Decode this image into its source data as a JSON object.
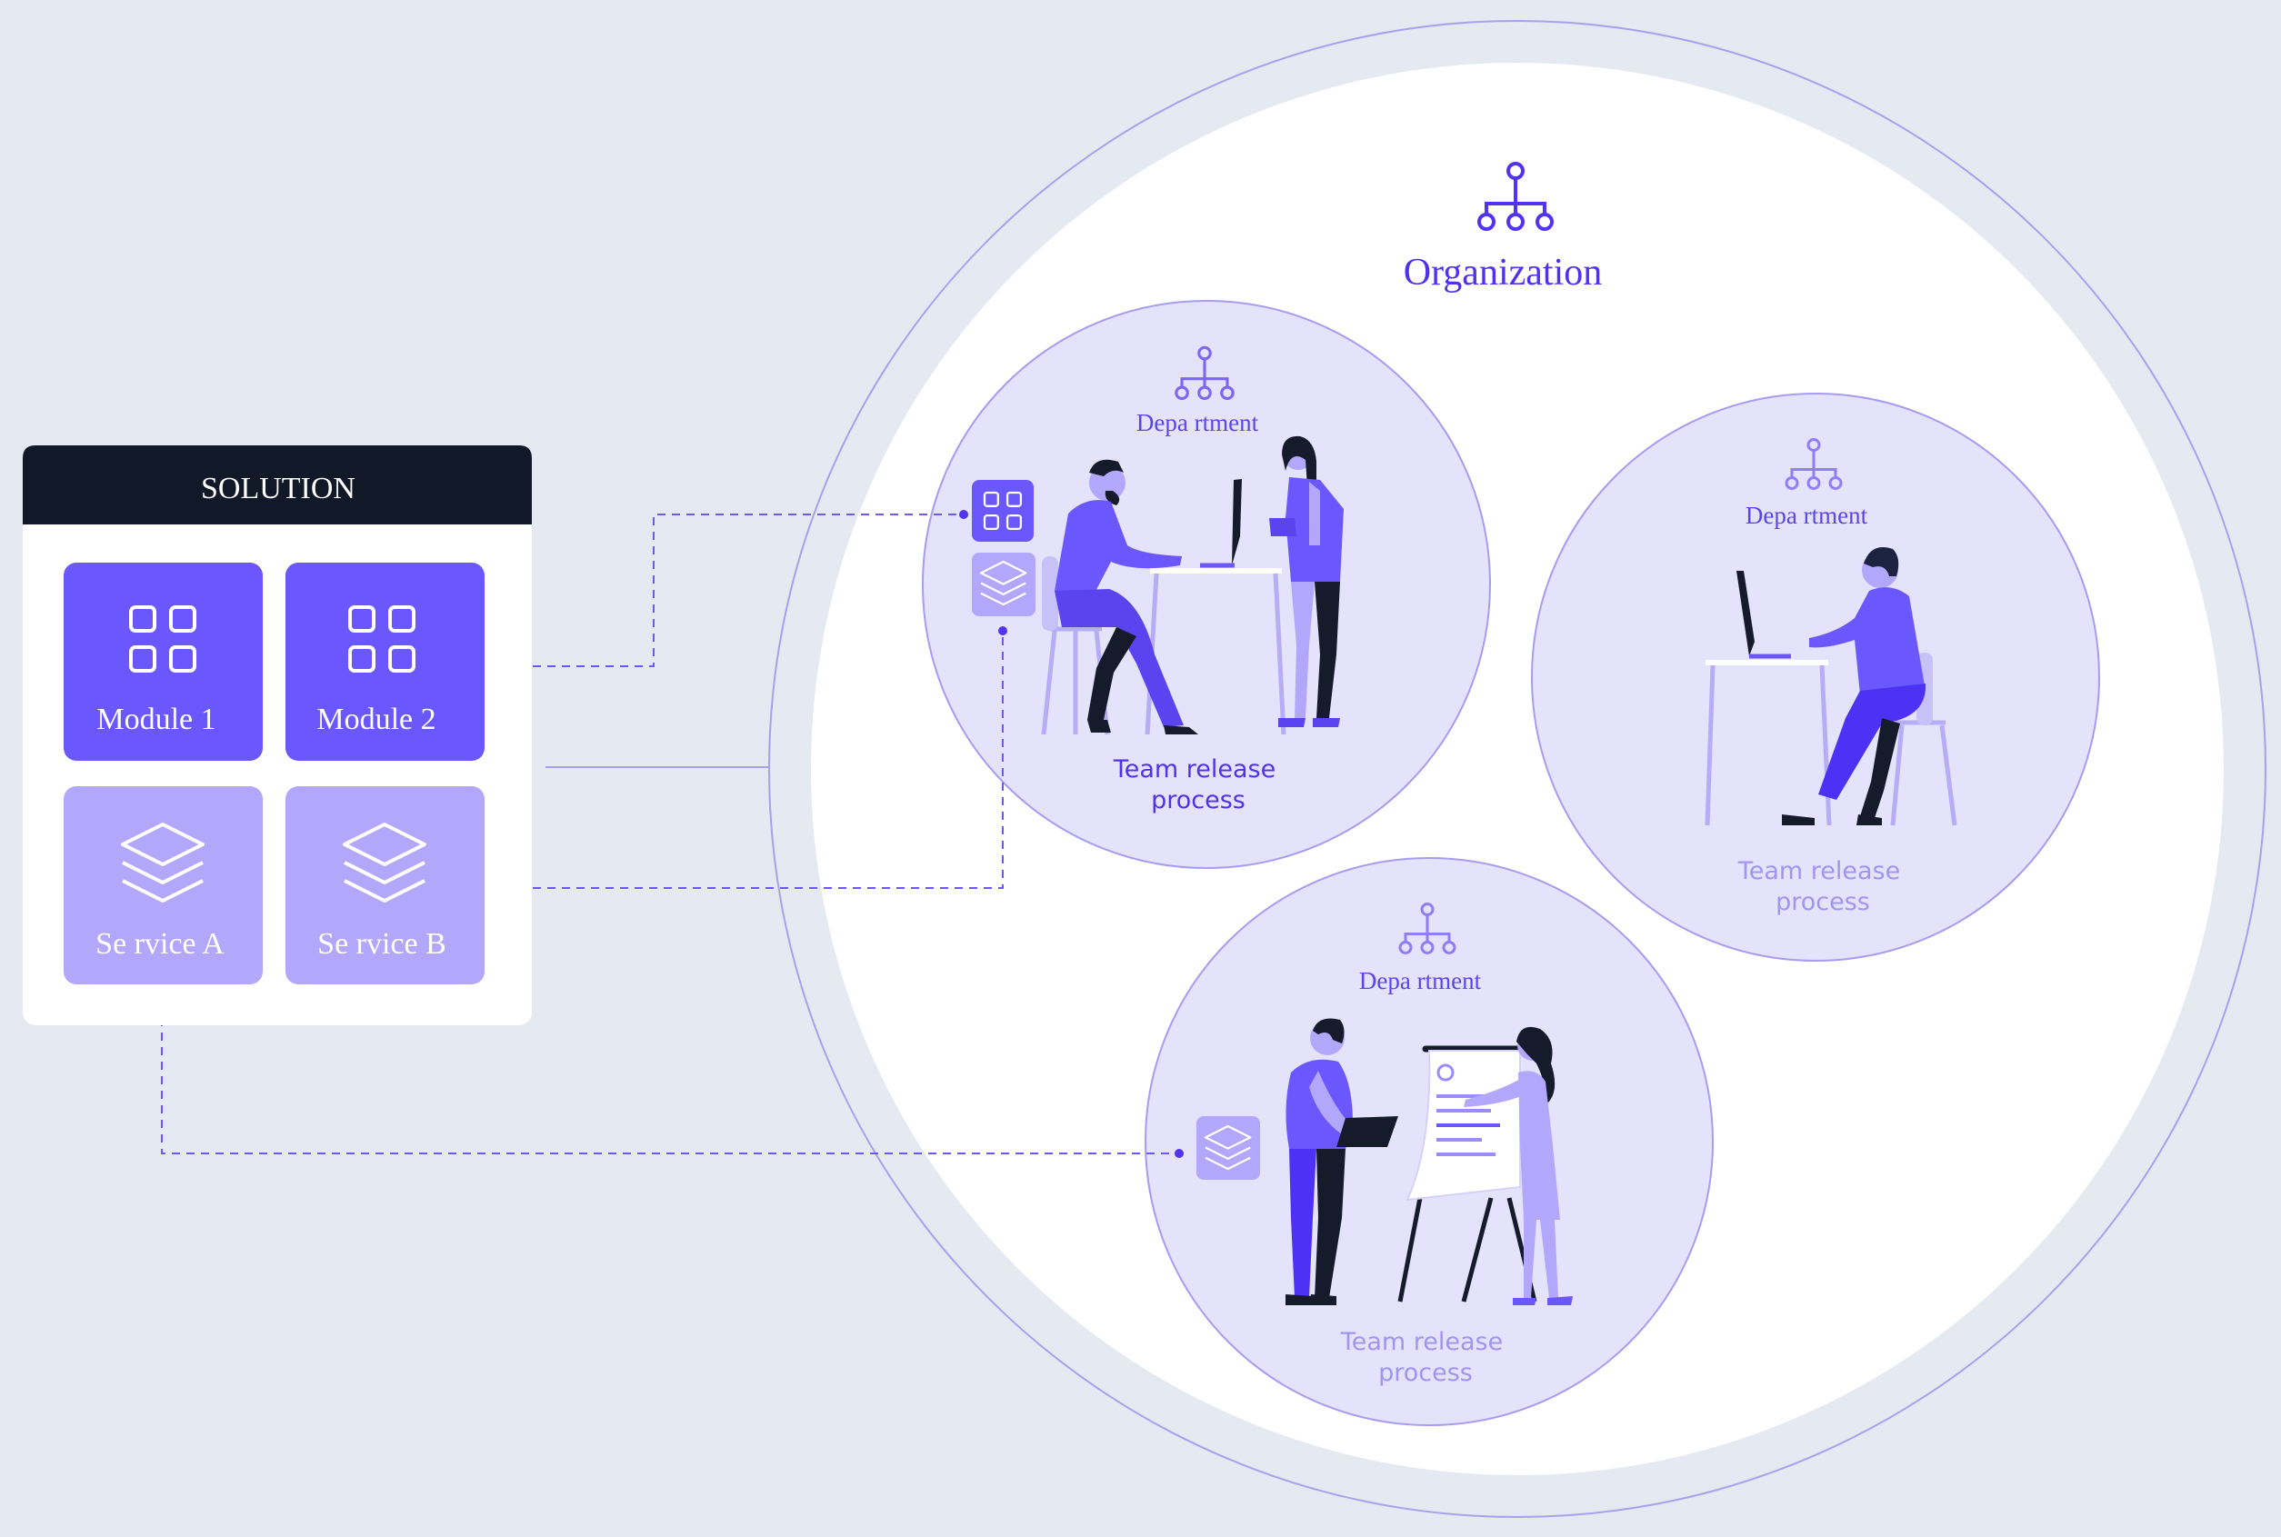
{
  "colors": {
    "background": "#e5e9f1",
    "primary": "#6b57fe",
    "primary_dark": "#4d32f5",
    "light": "#b3a7fc",
    "dept_fill": "#e5e3fb",
    "dept_stroke": "#a79cf0",
    "header_bg": "#111827",
    "figure_dark": "#161b2c"
  },
  "solution": {
    "title": "SOLUTION",
    "modules": [
      {
        "label": "Module 1",
        "icon": "grid-icon"
      },
      {
        "label": "Module 2",
        "icon": "grid-icon"
      }
    ],
    "services": [
      {
        "label": "Se rvice A",
        "icon": "layers-icon"
      },
      {
        "label": "Se rvice B",
        "icon": "layers-icon"
      }
    ]
  },
  "organization": {
    "title": "Organization",
    "icon": "org-chart-icon",
    "departments": [
      {
        "label": "Depa rtment",
        "process": "Team release process",
        "process_line1": "Team release",
        "process_line2": "process",
        "icon": "org-chart-icon",
        "scene": "desk-meeting"
      },
      {
        "label": "Depa rtment",
        "process": "Team release process",
        "process_line1": "Team release",
        "process_line2": "process",
        "icon": "org-chart-icon",
        "scene": "desk-solo"
      },
      {
        "label": "Depa rtment",
        "process": "Team release process",
        "process_line1": "Team release",
        "process_line2": "process",
        "icon": "org-chart-icon",
        "scene": "flipchart-presentation"
      }
    ]
  }
}
